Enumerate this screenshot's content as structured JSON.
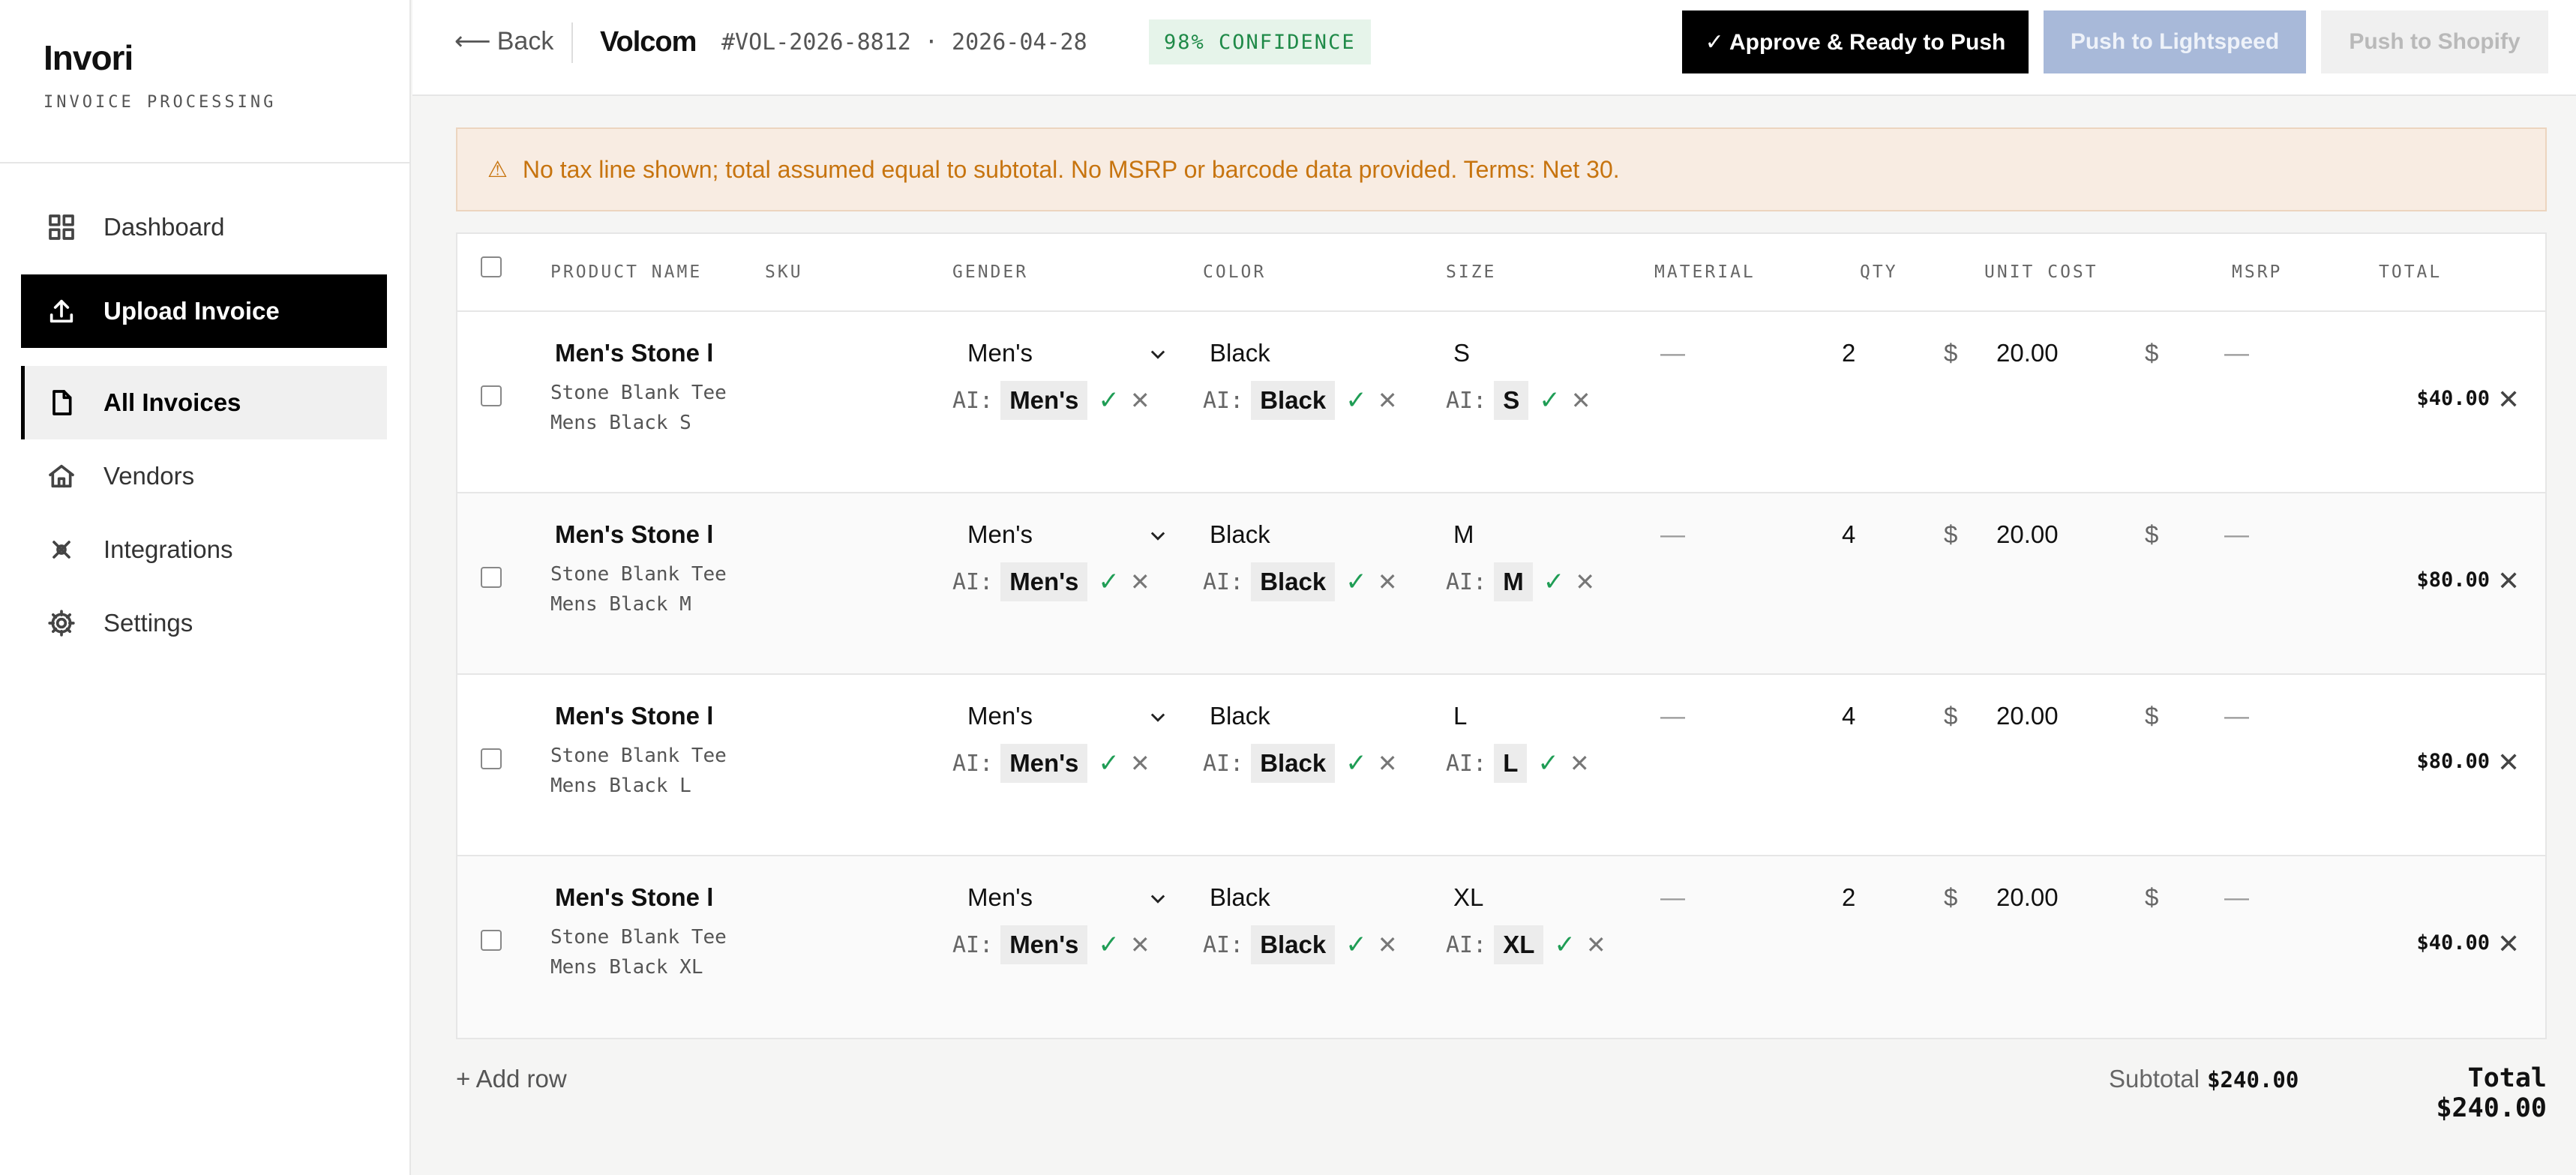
{
  "app": {
    "name": "Invori",
    "subtitle": "INVOICE PROCESSING"
  },
  "sidebar": {
    "items": [
      {
        "label": "Dashboard",
        "icon": "grid-icon"
      },
      {
        "label": "Upload Invoice",
        "icon": "upload-icon"
      },
      {
        "label": "All Invoices",
        "icon": "document-icon"
      },
      {
        "label": "Vendors",
        "icon": "house-icon"
      },
      {
        "label": "Integrations",
        "icon": "link-icon"
      },
      {
        "label": "Settings",
        "icon": "gear-icon"
      }
    ]
  },
  "header": {
    "back_label": "Back",
    "vendor": "Volcom",
    "invoice_meta": "#VOL-2026-8812 · 2026-04-28",
    "confidence": "98% CONFIDENCE",
    "approve_label": "✓ Approve & Ready to Push",
    "push_lightspeed_label": "Push to Lightspeed",
    "push_shopify_label": "Push to Shopify"
  },
  "alert": {
    "icon": "warning-icon",
    "text": "No tax line shown; total assumed equal to subtotal. No MSRP or barcode data provided. Terms: Net 30."
  },
  "table": {
    "columns": [
      "PRODUCT NAME",
      "SKU",
      "GENDER",
      "COLOR",
      "SIZE",
      "MATERIAL",
      "QTY",
      "UNIT COST",
      "MSRP",
      "TOTAL"
    ],
    "ai_label": "AI:",
    "currency": "$",
    "empty": "—",
    "rows": [
      {
        "name": "Men's Stone l",
        "desc": "Stone Blank Tee Mens Black S",
        "gender": "Men's",
        "ai_gender": "Men's",
        "color": "Black",
        "ai_color": "Black",
        "size": "S",
        "ai_size": "S",
        "qty": "2",
        "unit_cost": "20.00",
        "total": "$40.00"
      },
      {
        "name": "Men's Stone l",
        "desc": "Stone Blank Tee Mens Black M",
        "gender": "Men's",
        "ai_gender": "Men's",
        "color": "Black",
        "ai_color": "Black",
        "size": "M",
        "ai_size": "M",
        "qty": "4",
        "unit_cost": "20.00",
        "total": "$80.00"
      },
      {
        "name": "Men's Stone l",
        "desc": "Stone Blank Tee Mens Black L",
        "gender": "Men's",
        "ai_gender": "Men's",
        "color": "Black",
        "ai_color": "Black",
        "size": "L",
        "ai_size": "L",
        "qty": "4",
        "unit_cost": "20.00",
        "total": "$80.00"
      },
      {
        "name": "Men's Stone l",
        "desc": "Stone Blank Tee Mens Black XL",
        "gender": "Men's",
        "ai_gender": "Men's",
        "color": "Black",
        "ai_color": "Black",
        "size": "XL",
        "ai_size": "XL",
        "qty": "2",
        "unit_cost": "20.00",
        "total": "$40.00"
      }
    ]
  },
  "footer": {
    "add_row_label": "+ Add row",
    "subtotal_label": "Subtotal",
    "subtotal_value": "$240.00",
    "total_label": "Total $240.00"
  },
  "colors": {
    "accent": "#000000",
    "confidence_bg": "#e6f4ea",
    "confidence_text": "#1f8a48",
    "alert_bg": "#f8ece2",
    "alert_text": "#c7740f",
    "lightspeed_button": "#a8b9d9",
    "check_green": "#1f9d55"
  }
}
